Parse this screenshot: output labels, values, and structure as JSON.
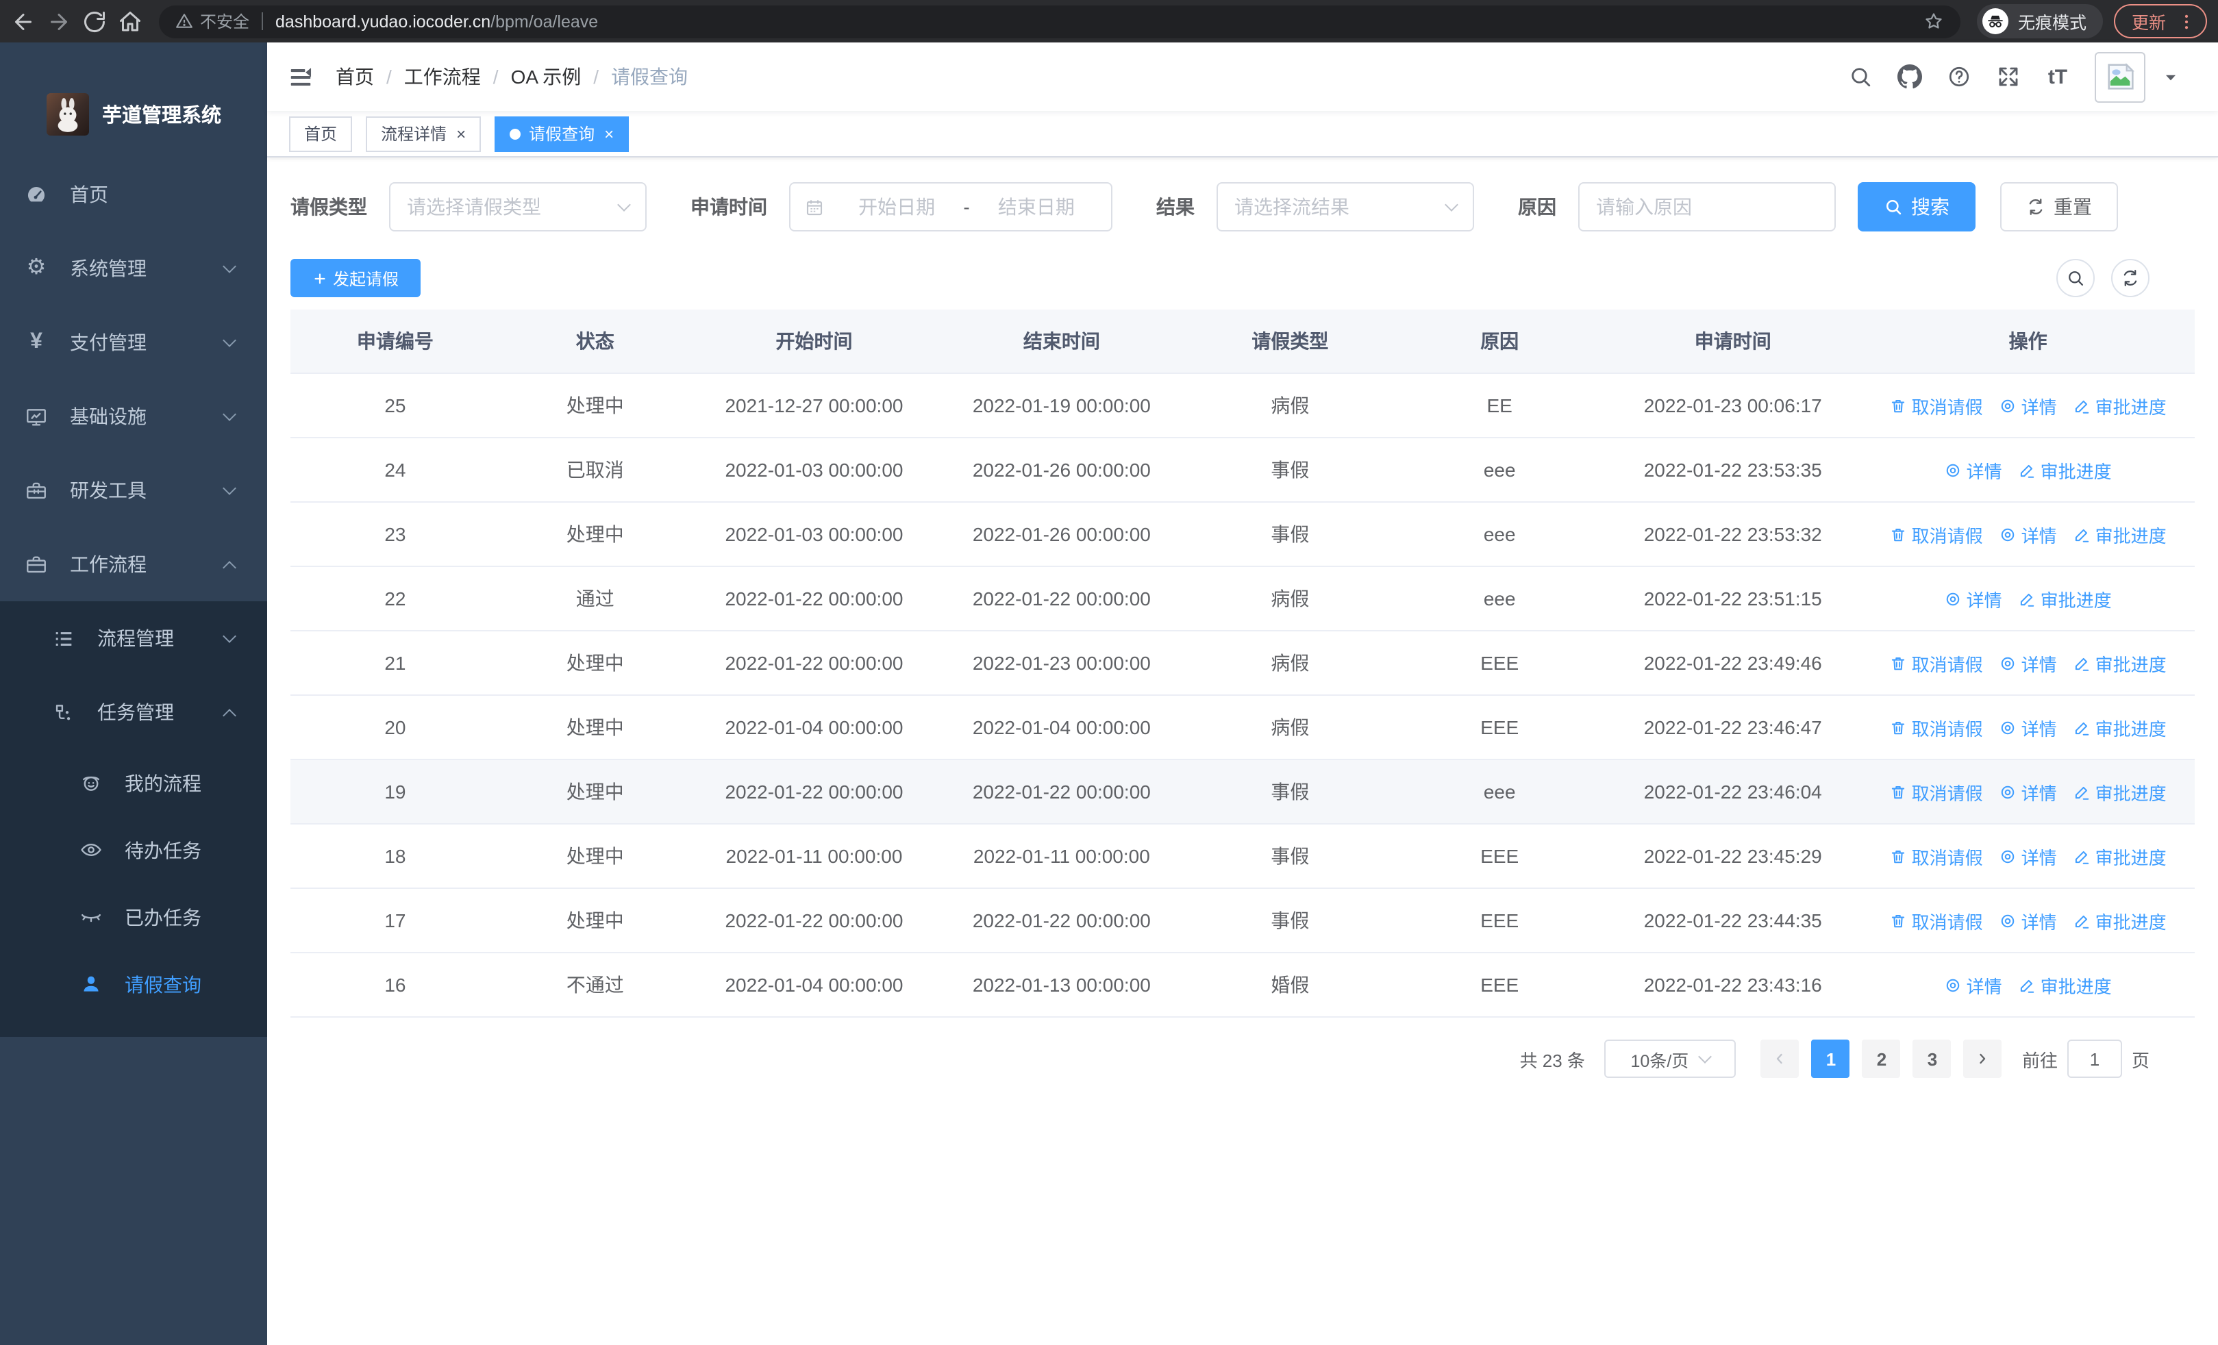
{
  "browser": {
    "security_label": "不安全",
    "url_host": "dashboard.yudao.iocoder.cn",
    "url_path": "/bpm/oa/leave",
    "incognito_label": "无痕模式",
    "update_label": "更新"
  },
  "colors": {
    "accent": "#409eff",
    "sidebar_bg": "#304156",
    "submenu_bg": "#1f2d3d",
    "chrome_bg": "#2b2c2f",
    "update_accent": "#ec9086",
    "table_header_bg": "#f5f7fa",
    "link": "#409eff"
  },
  "sidebar": {
    "title": "芋道管理系统",
    "menu": [
      {
        "name": "home",
        "label": "首页",
        "icon": "dashboard-icon",
        "level": 1
      },
      {
        "name": "system-management",
        "label": "系统管理",
        "icon": "gear-icon",
        "level": 1,
        "chevron": "down"
      },
      {
        "name": "payment-management",
        "label": "支付管理",
        "icon": "yen-icon",
        "level": 1,
        "chevron": "down"
      },
      {
        "name": "infrastructure",
        "label": "基础设施",
        "icon": "monitor-icon",
        "level": 1,
        "chevron": "down"
      },
      {
        "name": "dev-tools",
        "label": "研发工具",
        "icon": "toolbox-icon",
        "level": 1,
        "chevron": "down"
      },
      {
        "name": "workflow",
        "label": "工作流程",
        "icon": "briefcase-icon",
        "level": 1,
        "chevron": "up"
      },
      {
        "name": "process-management",
        "label": "流程管理",
        "icon": "list-icon",
        "level": 2,
        "chevron": "down",
        "dark": true
      },
      {
        "name": "task-management",
        "label": "任务管理",
        "icon": "flow-icon",
        "level": 2,
        "chevron": "up",
        "dark": true
      },
      {
        "name": "my-processes",
        "label": "我的流程",
        "icon": "face-icon",
        "level": 3,
        "dark": true
      },
      {
        "name": "todo-tasks",
        "label": "待办任务",
        "icon": "eye-open-icon",
        "level": 3,
        "dark": true
      },
      {
        "name": "done-tasks",
        "label": "已办任务",
        "icon": "eye-closed-icon",
        "level": 3,
        "dark": true
      },
      {
        "name": "leave-query",
        "label": "请假查询",
        "icon": "user-icon",
        "level": 3,
        "dark": true,
        "active": true
      }
    ]
  },
  "navbar": {
    "breadcrumb": [
      "首页",
      "工作流程",
      "OA 示例",
      "请假查询"
    ],
    "icons": [
      "search-icon",
      "github-icon",
      "help-icon",
      "fullscreen-icon",
      "font-size-icon"
    ]
  },
  "tabs": [
    {
      "name": "tab-home",
      "label": "首页",
      "active": false,
      "closable": false
    },
    {
      "name": "tab-process-detail",
      "label": "流程详情",
      "active": false,
      "closable": true
    },
    {
      "name": "tab-leave-query",
      "label": "请假查询",
      "active": true,
      "closable": true
    }
  ],
  "filters": {
    "leave_type": {
      "label": "请假类型",
      "placeholder": "请选择请假类型"
    },
    "apply_time": {
      "label": "申请时间",
      "start_placeholder": "开始日期",
      "separator": "-",
      "end_placeholder": "结束日期"
    },
    "result": {
      "label": "结果",
      "placeholder": "请选择流结果"
    },
    "reason": {
      "label": "原因",
      "placeholder": "请输入原因"
    },
    "search_label": "搜索",
    "reset_label": "重置"
  },
  "toolbar": {
    "create_label": "发起请假"
  },
  "table": {
    "columns": [
      "申请编号",
      "状态",
      "开始时间",
      "结束时间",
      "请假类型",
      "原因",
      "申请时间",
      "操作"
    ],
    "action_labels": {
      "cancel": "取消请假",
      "detail": "详情",
      "progress": "审批进度"
    },
    "action_icons": {
      "cancel": "trash-icon",
      "detail": "eye-icon",
      "progress": "pen-icon"
    },
    "rows": [
      {
        "id": "25",
        "status": "处理中",
        "start": "2021-12-27 00:00:00",
        "end": "2022-01-19 00:00:00",
        "type": "病假",
        "reason": "EE",
        "apply": "2022-01-23 00:06:17",
        "actions": [
          "cancel",
          "detail",
          "progress"
        ]
      },
      {
        "id": "24",
        "status": "已取消",
        "start": "2022-01-03 00:00:00",
        "end": "2022-01-26 00:00:00",
        "type": "事假",
        "reason": "eee",
        "apply": "2022-01-22 23:53:35",
        "actions": [
          "detail",
          "progress"
        ]
      },
      {
        "id": "23",
        "status": "处理中",
        "start": "2022-01-03 00:00:00",
        "end": "2022-01-26 00:00:00",
        "type": "事假",
        "reason": "eee",
        "apply": "2022-01-22 23:53:32",
        "actions": [
          "cancel",
          "detail",
          "progress"
        ]
      },
      {
        "id": "22",
        "status": "通过",
        "start": "2022-01-22 00:00:00",
        "end": "2022-01-22 00:00:00",
        "type": "病假",
        "reason": "eee",
        "apply": "2022-01-22 23:51:15",
        "actions": [
          "detail",
          "progress"
        ]
      },
      {
        "id": "21",
        "status": "处理中",
        "start": "2022-01-22 00:00:00",
        "end": "2022-01-23 00:00:00",
        "type": "病假",
        "reason": "EEE",
        "apply": "2022-01-22 23:49:46",
        "actions": [
          "cancel",
          "detail",
          "progress"
        ]
      },
      {
        "id": "20",
        "status": "处理中",
        "start": "2022-01-04 00:00:00",
        "end": "2022-01-04 00:00:00",
        "type": "病假",
        "reason": "EEE",
        "apply": "2022-01-22 23:46:47",
        "actions": [
          "cancel",
          "detail",
          "progress"
        ]
      },
      {
        "id": "19",
        "status": "处理中",
        "start": "2022-01-22 00:00:00",
        "end": "2022-01-22 00:00:00",
        "type": "事假",
        "reason": "eee",
        "apply": "2022-01-22 23:46:04",
        "actions": [
          "cancel",
          "detail",
          "progress"
        ],
        "highlighted": true
      },
      {
        "id": "18",
        "status": "处理中",
        "start": "2022-01-11 00:00:00",
        "end": "2022-01-11 00:00:00",
        "type": "事假",
        "reason": "EEE",
        "apply": "2022-01-22 23:45:29",
        "actions": [
          "cancel",
          "detail",
          "progress"
        ]
      },
      {
        "id": "17",
        "status": "处理中",
        "start": "2022-01-22 00:00:00",
        "end": "2022-01-22 00:00:00",
        "type": "事假",
        "reason": "EEE",
        "apply": "2022-01-22 23:44:35",
        "actions": [
          "cancel",
          "detail",
          "progress"
        ]
      },
      {
        "id": "16",
        "status": "不通过",
        "start": "2022-01-04 00:00:00",
        "end": "2022-01-13 00:00:00",
        "type": "婚假",
        "reason": "EEE",
        "apply": "2022-01-22 23:43:16",
        "actions": [
          "detail",
          "progress"
        ]
      }
    ]
  },
  "pagination": {
    "total_label": "共 23 条",
    "page_size_label": "10条/页",
    "pages": [
      "1",
      "2",
      "3"
    ],
    "active_page": "1",
    "goto_label": "前往",
    "goto_value": "1",
    "page_suffix": "页"
  }
}
